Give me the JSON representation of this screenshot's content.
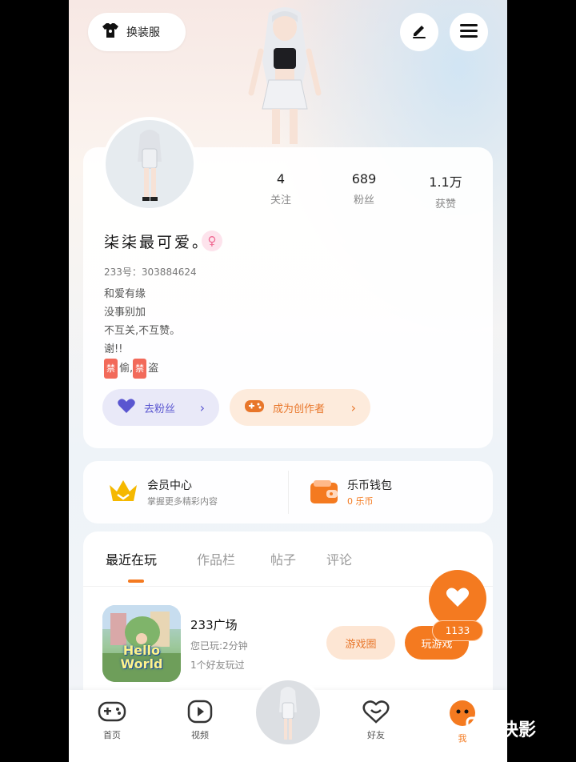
{
  "header": {
    "outfit_label": "换装服"
  },
  "stats": [
    {
      "value": "4",
      "label": "关注"
    },
    {
      "value": "689",
      "label": "粉丝"
    },
    {
      "value": "1.1万",
      "label": "获赞"
    }
  ],
  "profile": {
    "nickname": "柒柒最可爱。",
    "uid": "233号：303884624",
    "bio_lines": [
      "和爱有缘",
      "没事别加",
      "不互关,不互赞。",
      "谢!!"
    ],
    "bio_tag_line": {
      "tag1": "禁",
      "text1": "偷,",
      "tag2": "禁",
      "text2": "盗"
    }
  },
  "actions": {
    "fans_label": "去粉丝",
    "creator_label": "成为创作者"
  },
  "member": {
    "title": "会员中心",
    "subtitle": "掌握更多精彩内容"
  },
  "wallet": {
    "title": "乐币钱包",
    "subtitle": "0 乐币"
  },
  "tabs": [
    "最近在玩",
    "作品栏",
    "帖子",
    "评论"
  ],
  "game": {
    "name": "233广场",
    "icon_text": "Hello World",
    "played": "您已玩:2分钟",
    "friends": "1个好友玩过",
    "pack_label": "游戏圈",
    "play_label": "玩游戏"
  },
  "float": {
    "count": "1133"
  },
  "nav": {
    "home": "首页",
    "video": "视频",
    "friends": "好友",
    "me": "我"
  },
  "watermark": "快影",
  "colors": {
    "accent": "#f47a20",
    "fans": "#5a56d0",
    "badge": "#f06b93"
  }
}
